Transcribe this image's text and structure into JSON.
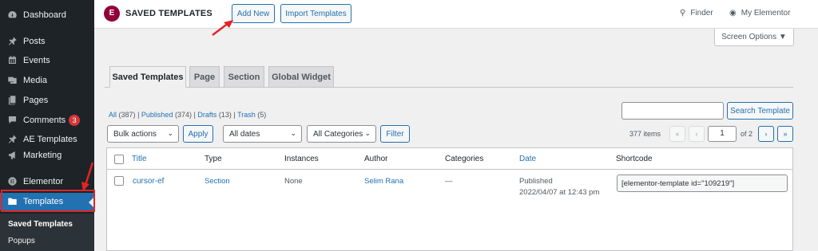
{
  "sidebar": {
    "items": [
      {
        "label": "Dashboard",
        "icon": "dashboard-icon"
      },
      {
        "label": "Posts",
        "icon": "pin-icon"
      },
      {
        "label": "Events",
        "icon": "calendar-icon"
      },
      {
        "label": "Media",
        "icon": "media-icon"
      },
      {
        "label": "Pages",
        "icon": "pages-icon"
      },
      {
        "label": "Comments",
        "icon": "comment-icon",
        "badge": "3"
      },
      {
        "label": "AE Templates",
        "icon": "pin-icon"
      },
      {
        "label": "Marketing",
        "icon": "megaphone-icon"
      },
      {
        "label": "Elementor",
        "icon": "elementor-icon"
      },
      {
        "label": "Templates",
        "icon": "folder-icon"
      }
    ],
    "submenu": [
      "Saved Templates",
      "Popups"
    ]
  },
  "header": {
    "logo_glyph": "E",
    "title": "SAVED TEMPLATES",
    "add_new": "Add New",
    "import": "Import Templates",
    "finder": "Finder",
    "my_elementor": "My Elementor"
  },
  "screen_options": "Screen Options ▼",
  "tabs": [
    "Saved Templates",
    "Page",
    "Section",
    "Global Widget"
  ],
  "views": {
    "all": "All",
    "all_count": "(387)",
    "published": "Published",
    "published_count": "(374)",
    "drafts": "Drafts",
    "drafts_count": "(13)",
    "trash": "Trash",
    "trash_count": "(5)",
    "sep": "|"
  },
  "search": {
    "button": "Search Template"
  },
  "filters": {
    "bulk_actions": "Bulk actions",
    "apply": "Apply",
    "dates": "All dates",
    "categories": "All Categories",
    "filter": "Filter"
  },
  "pagination": {
    "items": "377 items",
    "first": "«",
    "prev": "‹",
    "next": "›",
    "last": "»",
    "current": "1",
    "of": "of 2"
  },
  "table": {
    "headers": [
      "Title",
      "Type",
      "Instances",
      "Author",
      "Categories",
      "Date",
      "Shortcode"
    ],
    "rows": [
      {
        "title": "cursor-ef",
        "type": "Section",
        "instances": "None",
        "author": "Selim Rana",
        "categories": "—",
        "date_status": "Published",
        "date": "2022/04/07 at 12:43 pm",
        "shortcode": "[elementor-template id=\"109219\"]"
      }
    ]
  },
  "colors": {
    "accent": "#2271b1",
    "sidebar": "#1d2327",
    "annotation": "#e32424",
    "brand": "#92003b"
  }
}
